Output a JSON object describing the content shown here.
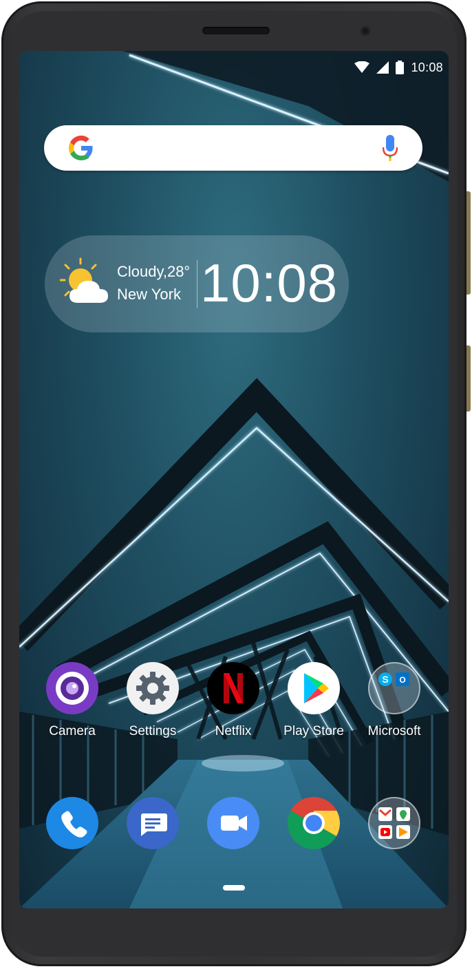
{
  "status_bar": {
    "time": "10:08",
    "icons": [
      "wifi-icon",
      "signal-icon",
      "battery-icon"
    ]
  },
  "search_bar": {
    "logo": "google-g-icon",
    "mic": "mic-icon"
  },
  "weather_widget": {
    "condition_temp": "Cloudy,28°",
    "city": "New York",
    "time": "10:08",
    "icon": "partly-cloudy-icon"
  },
  "home_apps": [
    {
      "label": "Camera",
      "icon": "camera-icon"
    },
    {
      "label": "Settings",
      "icon": "settings-gear-icon"
    },
    {
      "label": "Netflix",
      "icon": "netflix-icon"
    },
    {
      "label": "Play Store",
      "icon": "play-store-icon"
    },
    {
      "label": "Microsoft",
      "icon": "microsoft-folder-icon"
    }
  ],
  "dock_apps": [
    {
      "name": "Phone",
      "icon": "phone-icon"
    },
    {
      "name": "Messages",
      "icon": "messages-icon"
    },
    {
      "name": "Duo",
      "icon": "video-call-icon"
    },
    {
      "name": "Chrome",
      "icon": "chrome-icon"
    },
    {
      "name": "Google",
      "icon": "google-folder-icon"
    }
  ],
  "colors": {
    "wallpaper": "#1f5062",
    "accent_glow": "#bfe8ff",
    "frame": "#323234"
  }
}
